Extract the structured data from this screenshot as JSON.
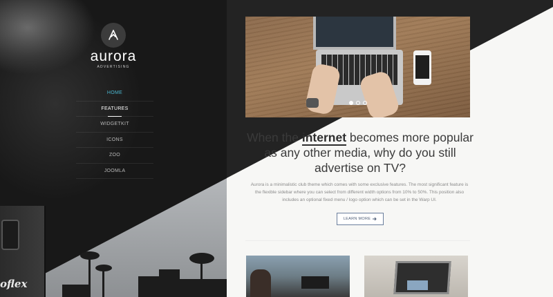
{
  "brand": {
    "name": "aurora",
    "tagline": "ADVERTISING"
  },
  "nav": {
    "items": [
      {
        "label": "HOME",
        "state": "active"
      },
      {
        "label": "FEATURES",
        "state": "current"
      },
      {
        "label": "WIDGETKIT",
        "state": "normal"
      },
      {
        "label": "ICONS",
        "state": "normal"
      },
      {
        "label": "ZOO",
        "state": "normal"
      },
      {
        "label": "JOOMLA",
        "state": "normal"
      }
    ]
  },
  "sidebar": {
    "camera_text": "oflex"
  },
  "main": {
    "headline": {
      "before": "When the",
      "emphasis": "internet",
      "after": "becomes more popular as any other media, why do you still advertise on TV?"
    },
    "body": "Aurora is a minimalistic club theme which comes with some exclusive features. The most significant feature is the flexible sidebar where you can select from different width options from 10% to 50%. This position also includes an optional fixed menu / logo option which can be set in the Warp UI.",
    "cta_label": "LEARN MORE",
    "slider": {
      "total": 3,
      "current": 1
    }
  },
  "colors": {
    "accent": "#4bb6cf",
    "dark": "#232323",
    "light": "#f7f7f5",
    "button_border": "#6a7e9c"
  }
}
